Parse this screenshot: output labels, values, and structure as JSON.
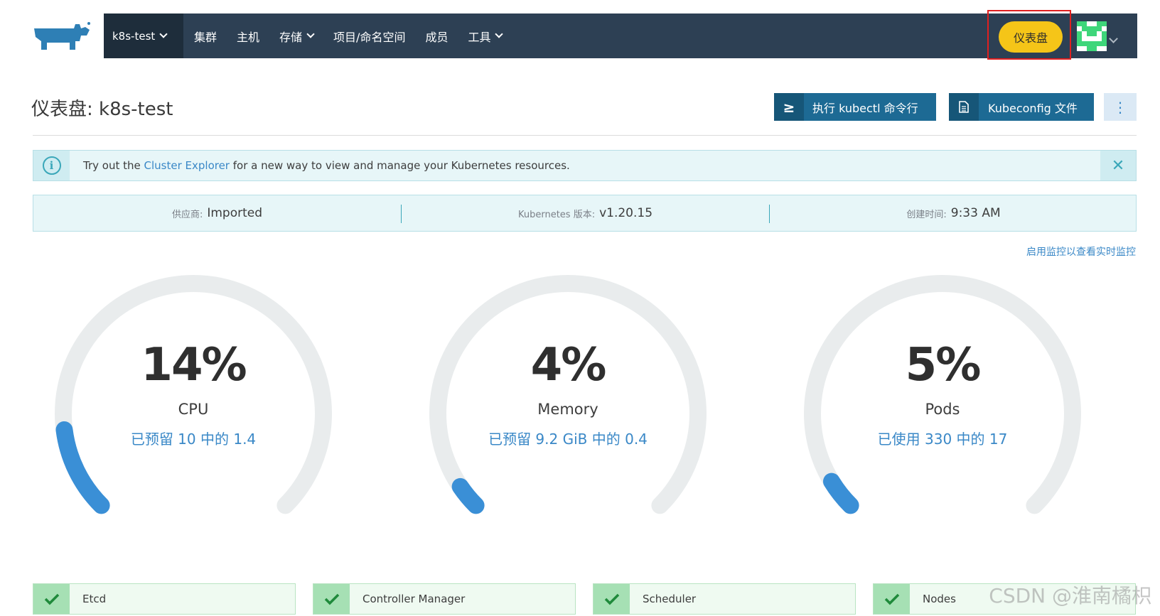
{
  "colors": {
    "navbar": "#2d4054",
    "cluster_select": "#1e2d3b",
    "dashboard_button": "#f5c518",
    "primary_button": "#1d6a94",
    "link": "#3a88c7",
    "info_bg": "#e7f6f8",
    "gauge_track": "#e9eced",
    "gauge_fill": "#3a8fd6",
    "success_bg": "#effaf1",
    "success_check": "#1f8a3b",
    "highlight_box": "#e02020"
  },
  "nav": {
    "cluster": "k8s-test",
    "items": [
      "集群",
      "主机",
      "存储",
      "项目/命名空间",
      "成员",
      "工具"
    ],
    "dashboard_button": "仪表盘"
  },
  "header": {
    "title": "仪表盘: k8s-test",
    "kubectl_icon": "≥",
    "kubectl_button": "执行 kubectl 命令行",
    "kubeconfig_button": "Kubeconfig 文件",
    "more_icon": "⋮"
  },
  "banner": {
    "prefix": "Try out the",
    "link": "Cluster Explorer",
    "suffix": "for a new way to view and manage your Kubernetes resources.",
    "close_icon": "✕"
  },
  "info": {
    "provider_label": "供应商:",
    "provider_value": "Imported",
    "k8s_label": "Kubernetes 版本:",
    "k8s_value": "v1.20.15",
    "created_label": "创建时间:",
    "created_value": "9:33 AM"
  },
  "monitoring_link": "启用监控以查看实时监控",
  "gauges": [
    {
      "percent": "14%",
      "value": 0.14,
      "label": "CPU",
      "detail": "已预留 10 中的 1.4"
    },
    {
      "percent": "4%",
      "value": 0.04,
      "label": "Memory",
      "detail": "已预留 9.2 GiB 中的 0.4"
    },
    {
      "percent": "5%",
      "value": 0.05,
      "label": "Pods",
      "detail": "已使用 330 中的 17"
    }
  ],
  "components": [
    {
      "name": "Etcd",
      "status": "healthy"
    },
    {
      "name": "Controller Manager",
      "status": "healthy"
    },
    {
      "name": "Scheduler",
      "status": "healthy"
    },
    {
      "name": "Nodes",
      "status": "healthy"
    }
  ],
  "watermark": "CSDN @淮南橘枳"
}
